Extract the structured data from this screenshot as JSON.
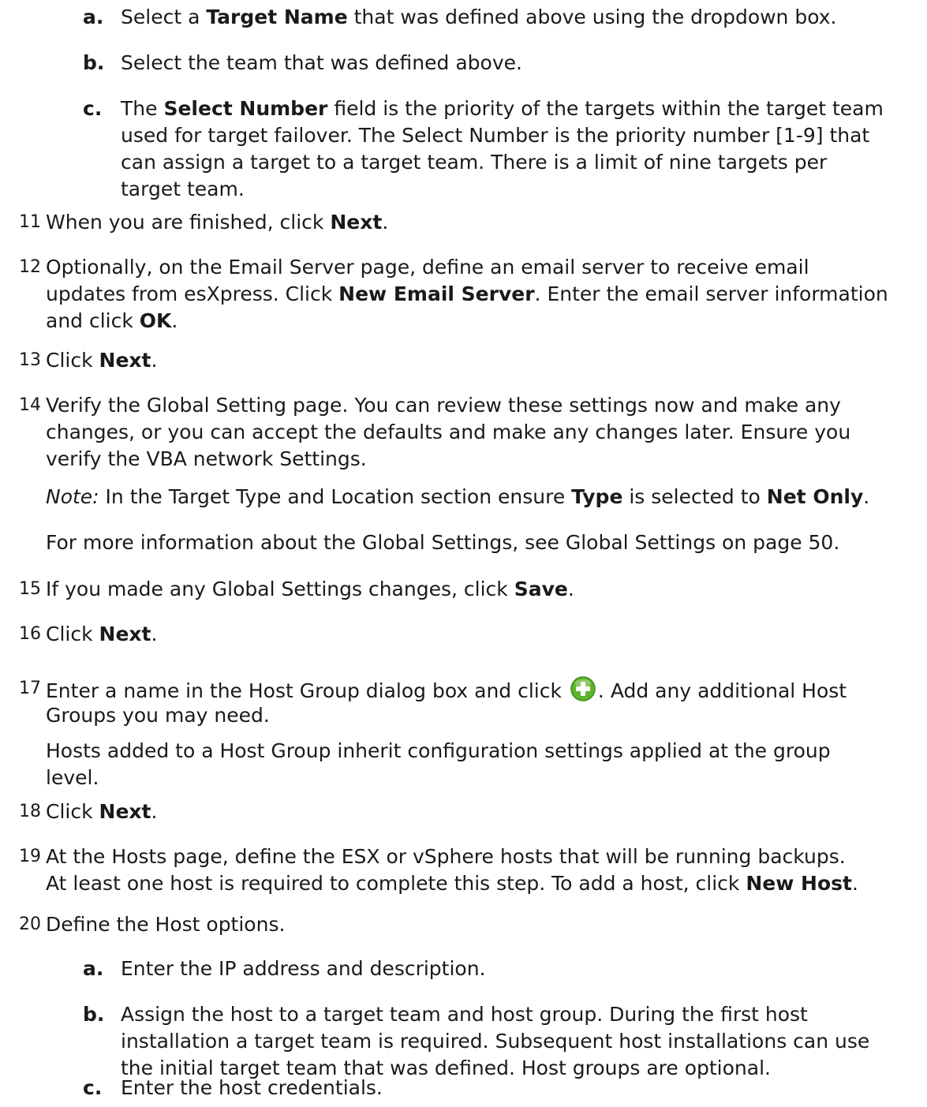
{
  "subA_top": {
    "letter": "a.",
    "lines": [
      [
        "Select a ",
        {
          "b": "Target Name"
        },
        " that was defined above using the dropdown box."
      ]
    ]
  },
  "subB_top": {
    "letter": "b.",
    "lines": [
      [
        "Select the team that was defined above."
      ]
    ]
  },
  "subC_top": {
    "letter": "c.",
    "lines": [
      [
        "The ",
        {
          "b": "Select Number"
        },
        " field is the priority of the targets within the target team"
      ],
      [
        "used for target failover.  The Select Number is the priority number [1-9] that"
      ],
      [
        "can assign a target to a target team. There is a limit of nine targets per"
      ],
      [
        "target team."
      ]
    ]
  },
  "step11": {
    "num": "11",
    "lines": [
      [
        "When you are finished, click ",
        {
          "b": "Next"
        },
        "."
      ]
    ]
  },
  "step12": {
    "num": "12",
    "lines": [
      [
        "Optionally, on the Email Server page, define an email server to receive email"
      ],
      [
        "updates from esXpress. Click ",
        {
          "b": "New Email Server"
        },
        ". Enter the email server information"
      ],
      [
        "and click ",
        {
          "b": "OK"
        },
        "."
      ]
    ]
  },
  "step13": {
    "num": "13",
    "lines": [
      [
        "Click ",
        {
          "b": "Next"
        },
        "."
      ]
    ]
  },
  "step14": {
    "num": "14",
    "lines": [
      [
        "Verify the Global Setting page. You can review these settings now and make any"
      ],
      [
        "changes, or you can accept the defaults and make any changes later. Ensure you"
      ],
      [
        "verify the VBA network Settings."
      ]
    ]
  },
  "step14_note": {
    "lines": [
      [
        {
          "i": "Note:"
        },
        " In the Target Type and Location section ensure ",
        {
          "b": "Type"
        },
        " is selected to ",
        {
          "b": "Net Only"
        },
        "."
      ]
    ]
  },
  "step14_more": {
    "lines": [
      [
        "For more information about the Global Settings, see Global Settings on page 50."
      ]
    ]
  },
  "step15": {
    "num": "15",
    "lines": [
      [
        "If you made any Global Settings changes, click ",
        {
          "b": "Save"
        },
        "."
      ]
    ]
  },
  "step16": {
    "num": "16",
    "lines": [
      [
        "Click ",
        {
          "b": "Next"
        },
        "."
      ]
    ]
  },
  "step17": {
    "num": "17",
    "lines": [
      [
        "Enter a name in the Host Group dialog box and click ",
        {
          "icon": "plus"
        },
        ". Add any additional Host"
      ],
      [
        "Groups you may need."
      ]
    ]
  },
  "step17_para": {
    "lines": [
      [
        "Hosts added to a Host Group inherit configuration settings applied at the group"
      ],
      [
        "level."
      ]
    ]
  },
  "step18": {
    "num": "18",
    "lines": [
      [
        "Click ",
        {
          "b": "Next"
        },
        "."
      ]
    ]
  },
  "step19": {
    "num": "19",
    "lines": [
      [
        "At the Hosts page, define the ESX or vSphere hosts that will be running backups."
      ],
      [
        "At least one host is required to complete this step. To add a host, click ",
        {
          "b": "New Host"
        },
        "."
      ]
    ]
  },
  "step20": {
    "num": "20",
    "lines": [
      [
        "Define the Host options."
      ]
    ]
  },
  "subA_bottom": {
    "letter": "a.",
    "lines": [
      [
        "Enter the IP address and description."
      ]
    ]
  },
  "subB_bottom": {
    "letter": "b.",
    "lines": [
      [
        "Assign the host to a target team and host group.  During the first host"
      ],
      [
        "installation a target team is required.  Subsequent host installations can use"
      ],
      [
        "the initial target team that was defined.  Host groups are optional."
      ]
    ]
  },
  "subC_bottom": {
    "letter": "c.",
    "lines": [
      [
        "Enter the host credentials."
      ]
    ]
  },
  "icons": {
    "plus": "add-circle-icon",
    "plus_color": "#5fb32d"
  }
}
